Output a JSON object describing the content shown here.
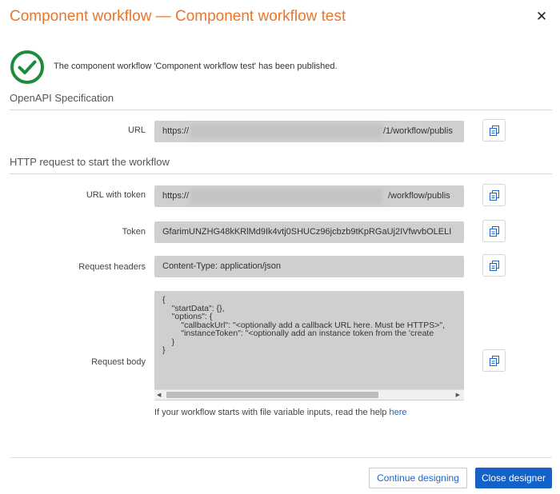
{
  "dialog": {
    "title": "Component workflow — Component workflow test",
    "close_glyph": "✕",
    "accent_color": "#e8762d",
    "success_color": "#1e8a3c",
    "success_message": "The component workflow 'Component workflow test' has been published."
  },
  "openapi": {
    "section_title": "OpenAPI Specification",
    "url_label": "URL",
    "url_prefix": "https://",
    "url_suffix": "/1/workflow/publis"
  },
  "http_request": {
    "section_title": "HTTP request to start the workflow",
    "url_with_token_label": "URL with token",
    "url_with_token_prefix": "https://",
    "url_with_token_suffix": "/workflow/publis",
    "token_label": "Token",
    "token_value": "GfarimUNZHG48kKRlMd9Ik4vtj0SHUCz96jcbzb9tKpRGaUj2IVfwvbOLELI",
    "request_headers_label": "Request headers",
    "request_headers_value": "Content-Type: application/json",
    "request_body_label": "Request body",
    "request_body_value": "{\n    \"startData\": {},\n    \"options\": {\n        \"callbackUrl\": \"<optionally add a callback URL here. Must be HTTPS>\",\n        \"instanceToken\": \"<optionally add an instance token from the 'create\n    }\n}",
    "copy_icon": "copy-icon"
  },
  "help": {
    "text": "If your workflow starts with file variable inputs, read the help ",
    "link_text": "here"
  },
  "footer": {
    "continue_label": "Continue designing",
    "close_label": "Close designer",
    "primary_color": "#1461c9"
  }
}
